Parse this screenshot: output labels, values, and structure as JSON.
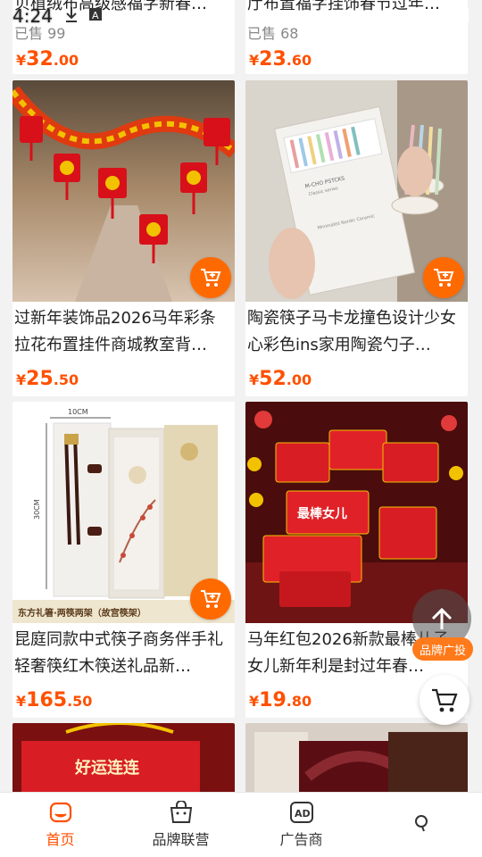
{
  "status": {
    "time": "4:24"
  },
  "top_row": [
    {
      "title": "贝植绒布高级感福字新春…",
      "sold": "已售 99",
      "price_symbol": "¥",
      "price_int": "32",
      "price_dec": ".00"
    },
    {
      "title": "厅布置福字挂饰春节过年…",
      "sold": "已售 68",
      "price_symbol": "¥",
      "price_int": "23",
      "price_dec": ".60"
    }
  ],
  "products": [
    {
      "title": "过新年装饰品2026马年彩条拉花布置挂件商城教室背…",
      "price_symbol": "¥",
      "price_int": "25",
      "price_dec": ".50"
    },
    {
      "title": "陶瓷筷子马卡龙撞色设计少女心彩色ins家用陶瓷勺子…",
      "price_symbol": "¥",
      "price_int": "52",
      "price_dec": ".00",
      "box_text_1": "M-CHO PSTCKS",
      "box_text_2": "Classic series",
      "box_text_3": "Minimalist Nordic Ceramic"
    },
    {
      "title": "昆庭同款中式筷子商务伴手礼轻奢筷红木筷送礼品新…",
      "price_symbol": "¥",
      "price_int": "165",
      "price_dec": ".50",
      "dim_w": "10CM",
      "dim_h": "30CM",
      "banner": "东方礼箸·两筷两架（故宫筷架）"
    },
    {
      "title": "马年红包2026新款最棒儿子女儿新年利是封过年春…",
      "price_symbol": "¥",
      "price_int": "19",
      "price_dec": ".80",
      "env_text": "最棒女儿"
    }
  ],
  "bottom_row": [
    {
      "box_text": "好运连连"
    },
    {
      "box_text": ""
    }
  ],
  "floating": {
    "brand_label": "品牌广投"
  },
  "nav": [
    {
      "label": "首页",
      "icon": "home-icon",
      "active": true
    },
    {
      "label": "品牌联营",
      "icon": "bag-icon",
      "active": false
    },
    {
      "label": "广告商",
      "icon": "ad-icon",
      "active": false
    },
    {
      "label": "",
      "icon": "search-icon",
      "active": false
    }
  ],
  "colors": {
    "accent": "#ff5000",
    "cart": "#ff6a00"
  }
}
